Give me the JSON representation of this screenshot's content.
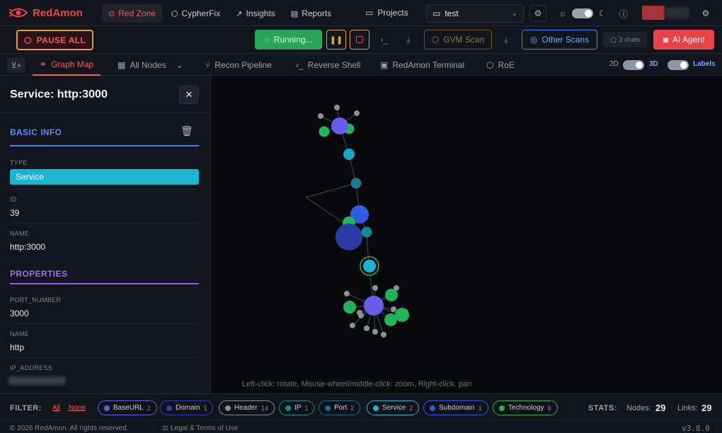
{
  "brand": {
    "name": "RedAmon"
  },
  "nav": {
    "red_zone": "Red Zone",
    "cypherfix": "CypherFix",
    "insights": "Insights",
    "reports": "Reports",
    "projects": "Projects",
    "project_selected": "test"
  },
  "actions": {
    "pause_all": "PAUSE ALL",
    "running": "Running...",
    "gvm_scan": "GVM Scan",
    "other_scans": "Other Scans",
    "chats": "2 chats",
    "ai_agent": "AI Agent"
  },
  "tabs": {
    "graph_map": "Graph Map",
    "all_nodes": "All Nodes",
    "recon_pipeline": "Recon Pipeline",
    "reverse_shell": "Reverse Shell",
    "terminal": "RedAmon Terminal",
    "roe": "RoE",
    "mode_2d": "2D",
    "mode_3d": "3D",
    "labels": "Labels"
  },
  "panel": {
    "title": "Service: http:3000",
    "basic_info": "BASIC INFO",
    "type_label": "TYPE",
    "type_value": "Service",
    "id_label": "ID",
    "id_value": "39",
    "name_label": "NAME",
    "name_value": "http:3000",
    "properties": "PROPERTIES",
    "port_label": "PORT_NUMBER",
    "port_value": "3000",
    "prop_name_label": "NAME",
    "prop_name_value": "http",
    "ip_label": "IP_ADDRESS"
  },
  "graph": {
    "hint": "Left-click: rotate, Mouse-wheel/middle-click: zoom, Right-click: pan"
  },
  "filter": {
    "label": "FILTER:",
    "all": "All",
    "none": "None",
    "chips": [
      {
        "name": "BaseURL",
        "count": "2",
        "color": "#6b5ce7"
      },
      {
        "name": "Domain",
        "count": "1",
        "color": "#2f3fb0"
      },
      {
        "name": "Header",
        "count": "14",
        "color": "#8a8f98"
      },
      {
        "name": "IP",
        "count": "1",
        "color": "#0f8f8f"
      },
      {
        "name": "Port",
        "count": "2",
        "color": "#1a6f8a"
      },
      {
        "name": "Service",
        "count": "2",
        "color": "#1bb5d2"
      },
      {
        "name": "Subdomain",
        "count": "1",
        "color": "#2f5fe0"
      },
      {
        "name": "Technology",
        "count": "6",
        "color": "#22b356"
      }
    ]
  },
  "stats": {
    "label": "STATS:",
    "nodes_label": "Nodes:",
    "nodes": "29",
    "links_label": "Links:",
    "links": "29"
  },
  "footer": {
    "copyright": "© 2026 RedAmon. All rights reserved.",
    "legal": "Legal & Terms of Use",
    "version": "v3.8.0"
  }
}
